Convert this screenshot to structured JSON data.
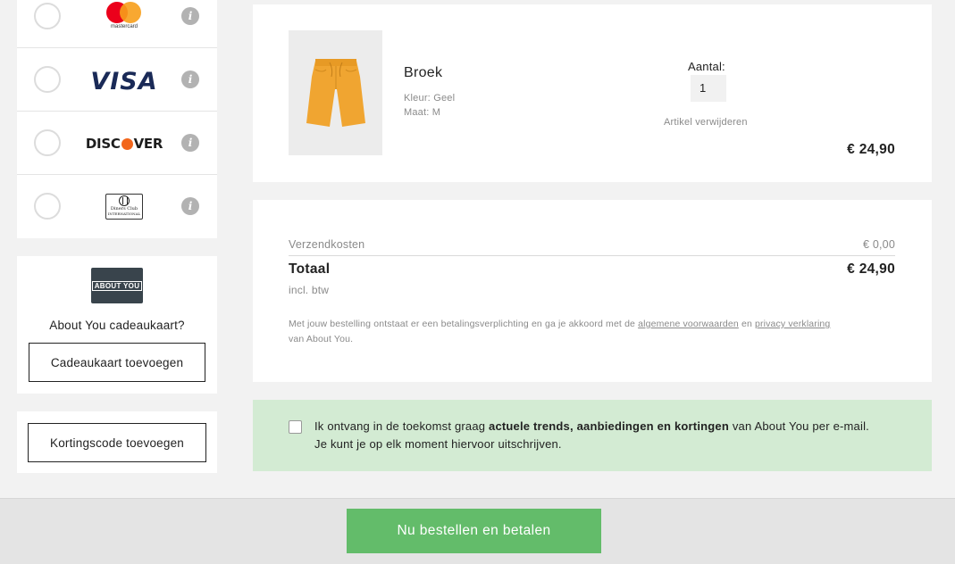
{
  "payment": {
    "methods": [
      {
        "name": "mastercard",
        "logo_text": "mastercard",
        "info": "i"
      },
      {
        "name": "visa",
        "logo_text": "VISA",
        "info": "i"
      },
      {
        "name": "discover",
        "logo_left": "DISC",
        "logo_right": "VER",
        "info": "i"
      },
      {
        "name": "diners",
        "logo_line1": "Diners Club",
        "logo_line2": "INTERNATIONAL",
        "info": "i"
      }
    ]
  },
  "giftcard": {
    "logo_text": "ABOUT YOU",
    "question": "About You cadeaukaart?",
    "button_label": "Cadeaukaart toevoegen"
  },
  "coupon": {
    "button_label": "Kortingscode toevoegen"
  },
  "product": {
    "name": "Broek",
    "color": "Kleur: Geel",
    "size": "Maat: M",
    "quantity_label": "Aantal:",
    "quantity": "1",
    "remove_label": "Artikel verwijderen",
    "price": "€ 24,90"
  },
  "summary": {
    "shipping_label": "Verzendkosten",
    "shipping_value": "€ 0,00",
    "total_label": "Totaal",
    "total_value": "€ 24,90",
    "vat_note": "incl. btw",
    "legal_prefix": "Met jouw bestelling ontstaat er een betalingsverplichting en ga je akkoord met de",
    "legal_terms_link": "algemene voorwaarden",
    "legal_and": "en",
    "legal_privacy_link": "privacy verklaring",
    "legal_suffix": "van About You."
  },
  "newsletter": {
    "text_before": "Ik ontvang in de toekomst graag",
    "text_bold": "actuele trends, aanbiedingen en kortingen",
    "text_after": "van About You per e-mail.",
    "line2": "Je kunt je op elk moment hiervoor uitschrijven."
  },
  "footer": {
    "order_button": "Nu bestellen en betalen"
  },
  "colors": {
    "accent_green": "#63bc6a",
    "newsletter_bg": "#d3ebd3",
    "product_color": "#f0a531"
  }
}
